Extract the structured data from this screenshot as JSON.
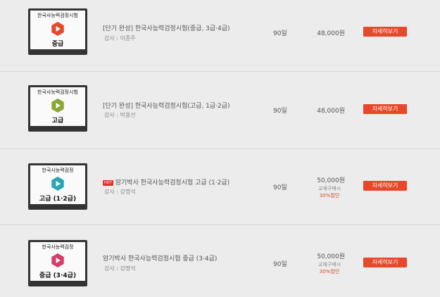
{
  "courses": [
    {
      "thumb_title": "한국사능력검정시험",
      "thumb_level": "중급",
      "play_color": "#e4472a",
      "hot": false,
      "title": "[단기 완성] 한국사능력검정시험(중급, 3급·4급)",
      "teacher": "강사 : 이종주",
      "period": "90일",
      "price": "48,000원",
      "note1": "",
      "note2": "",
      "button": "자세히보기"
    },
    {
      "thumb_title": "한국사능력검정시험",
      "thumb_level": "고급",
      "play_color": "#8aa634",
      "hot": false,
      "title": "[단기 완성] 한국사능력검정시험(고급, 1급·2급)",
      "teacher": "강사 : 박용선",
      "period": "90일",
      "price": "48,000원",
      "note1": "",
      "note2": "",
      "button": "자세히보기"
    },
    {
      "thumb_title": "한국사능력검정",
      "thumb_level": "고급 (1·2급)",
      "play_color": "#2aa5b3",
      "hot": true,
      "hot_label": "HOT",
      "title": "암기박사 한국사능력검정시험 고급 (1·2급)",
      "teacher": "강사 : 강명석",
      "period": "90일",
      "price": "50,000원",
      "note1": "교재구매시",
      "note2": "30%할인",
      "button": "자세히보기"
    },
    {
      "thumb_title": "한국사능력검정",
      "thumb_level": "중급 (3·4급)",
      "play_color": "#d63c6a",
      "hot": false,
      "title": "암기박사 한국사능력검정시험 중급 (3·4급)",
      "teacher": "강사 : 강명석",
      "period": "90일",
      "price": "50,000원",
      "note1": "교재구매시",
      "note2": "30%할인",
      "button": "자세히보기"
    }
  ]
}
